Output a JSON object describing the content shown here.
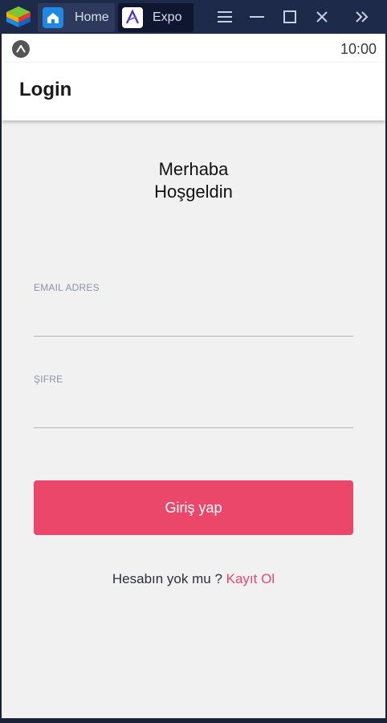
{
  "window": {
    "tabs": [
      {
        "label": "Home",
        "icon": "home-icon"
      },
      {
        "label": "Expo",
        "icon": "expo-app-icon"
      }
    ],
    "controls": [
      "menu-icon",
      "minimize-icon",
      "maximize-icon",
      "close-icon",
      "expand-sidebar-icon"
    ]
  },
  "statusbar": {
    "time": "10:00"
  },
  "appbar": {
    "title": "Login"
  },
  "greeting": {
    "line1": "Merhaba",
    "line2": "Hoşgeldin"
  },
  "form": {
    "email_label": "EMAIL ADRES",
    "email_value": "",
    "password_label": "ŞIFRE",
    "password_value": "",
    "submit_label": "Giriş yap"
  },
  "signup": {
    "prompt": "Hesabın yok mu ? ",
    "link": "Kayıt Ol"
  },
  "colors": {
    "accent": "#ea476b",
    "background": "#f1f1f1",
    "titlebar": "#1e2a4a"
  }
}
